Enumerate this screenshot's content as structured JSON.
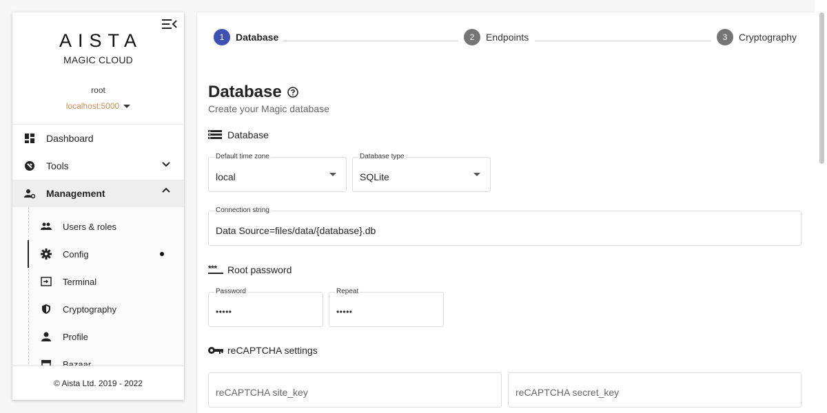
{
  "sidebar": {
    "logo": {
      "word": "AISTA",
      "subtitle": "MAGIC CLOUD"
    },
    "user": {
      "name": "root",
      "backend": "localhost:5000"
    },
    "nav": [
      {
        "label": "Dashboard",
        "icon": "dashboard-icon"
      },
      {
        "label": "Tools",
        "icon": "tools-icon"
      },
      {
        "label": "Management",
        "icon": "management-icon"
      }
    ],
    "management_items": [
      {
        "label": "Users & roles",
        "icon": "people-icon"
      },
      {
        "label": "Config",
        "icon": "gear-icon"
      },
      {
        "label": "Terminal",
        "icon": "terminal-icon"
      },
      {
        "label": "Cryptography",
        "icon": "shield-icon"
      },
      {
        "label": "Profile",
        "icon": "person-icon"
      },
      {
        "label": "Bazaar",
        "icon": "store-icon"
      }
    ],
    "footer": "© Aista Ltd. 2019 - 2022"
  },
  "stepper": {
    "steps": [
      {
        "num": "1",
        "label": "Database",
        "active": true
      },
      {
        "num": "2",
        "label": "Endpoints",
        "active": false
      },
      {
        "num": "3",
        "label": "Cryptography",
        "active": false
      }
    ]
  },
  "main": {
    "title": "Database",
    "subtitle": "Create your Magic database",
    "db_section": "Database",
    "timezone": {
      "label": "Default time zone",
      "value": "local"
    },
    "dbtype": {
      "label": "Database type",
      "value": "SQLite"
    },
    "connection": {
      "label": "Connection string",
      "value": "Data Source=files/data/{database}.db"
    },
    "root_section": "Root password",
    "root_icon_text": "***",
    "password": {
      "label": "Password",
      "value": "•••••"
    },
    "repeat": {
      "label": "Repeat",
      "value": "•••••"
    },
    "recaptcha_section": "reCAPTCHA settings",
    "site_key": {
      "placeholder": "reCAPTCHA site_key"
    },
    "secret_key": {
      "placeholder": "reCAPTCHA secret_key"
    }
  },
  "colors": {
    "accent": "#3f51b5",
    "step_inactive": "#757575",
    "backend": "#d08a55"
  }
}
